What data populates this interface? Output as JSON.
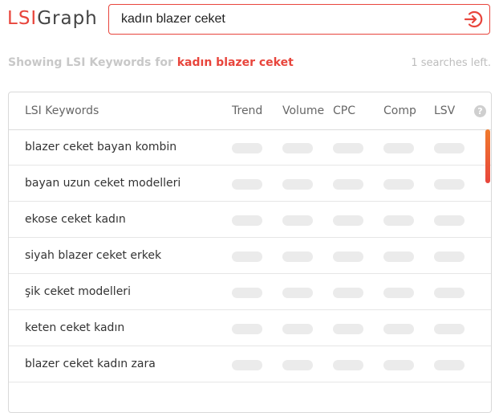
{
  "brand": {
    "logo_lsi": "LSI",
    "logo_graph": "Graph",
    "accent_color": "#e8453c"
  },
  "search": {
    "value": "kadın blazer ceket",
    "button_icon": "sign-in-arrow-icon"
  },
  "status": {
    "showing_prefix": "Showing LSI Keywords for",
    "keyword": "kadın blazer ceket",
    "searches_left": "1 searches left."
  },
  "table": {
    "headers": {
      "keywords": "LSI Keywords",
      "trend": "Trend",
      "volume": "Volume",
      "cpc": "CPC",
      "comp": "Comp",
      "lsv": "LSV",
      "help": "?"
    },
    "rows": [
      {
        "keyword": "blazer ceket bayan kombin"
      },
      {
        "keyword": "bayan uzun ceket modelleri"
      },
      {
        "keyword": "ekose ceket kadın"
      },
      {
        "keyword": "siyah blazer ceket erkek"
      },
      {
        "keyword": "şik ceket modelleri"
      },
      {
        "keyword": "keten ceket kadın"
      },
      {
        "keyword": "blazer ceket kadın zara"
      }
    ]
  }
}
